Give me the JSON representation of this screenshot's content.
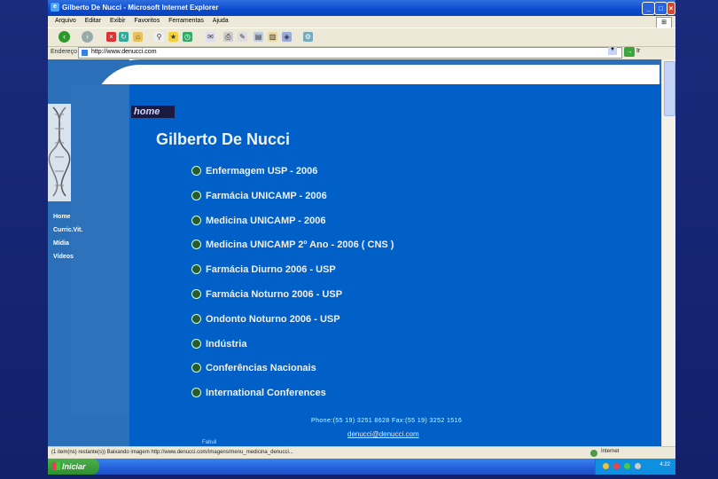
{
  "window": {
    "title": "Gilberto De Nucci - Microsoft Internet Explorer",
    "minimize_label": "_",
    "maximize_label": "□",
    "close_label": "×"
  },
  "menu": [
    "Arquivo",
    "Editar",
    "Exibir",
    "Favoritos",
    "Ferramentas",
    "Ajuda"
  ],
  "address": {
    "label": "Endereço",
    "url": "http://www.denucci.com",
    "go_label": "Ir"
  },
  "page": {
    "badge": "home",
    "heading": "Gilberto De Nucci",
    "nav": [
      "Home",
      "Curric.Vit.",
      "Mídia",
      "Vídeos"
    ],
    "links": [
      "Enfermagem USP - 2006",
      "Farmácia UNICAMP - 2006",
      "Medicina UNICAMP - 2006",
      "Medicina UNICAMP 2º Ano - 2006 ( CNS )",
      "Farmácia Diurno 2006 - USP",
      "Farmácia Noturno 2006 - USP",
      "Ondonto Noturno 2006 - USP",
      "Indústria",
      " Conferências Nacionais",
      "International Conferences"
    ],
    "footer_phone": "Phone:(55 19) 3251 8628 Fax:(55 19) 3252 1516",
    "footer_email": "denucci@denucci.com",
    "footer_small": "Fabuli"
  },
  "statusbar": {
    "text": "(1 item(ns) restante(s)) Baixando imagem http://www.denucci.com/imagens/menu_medicina_denucci...",
    "zone": "Internet"
  },
  "taskbar": {
    "start_label": "Iniciar",
    "clock": "4:22"
  }
}
